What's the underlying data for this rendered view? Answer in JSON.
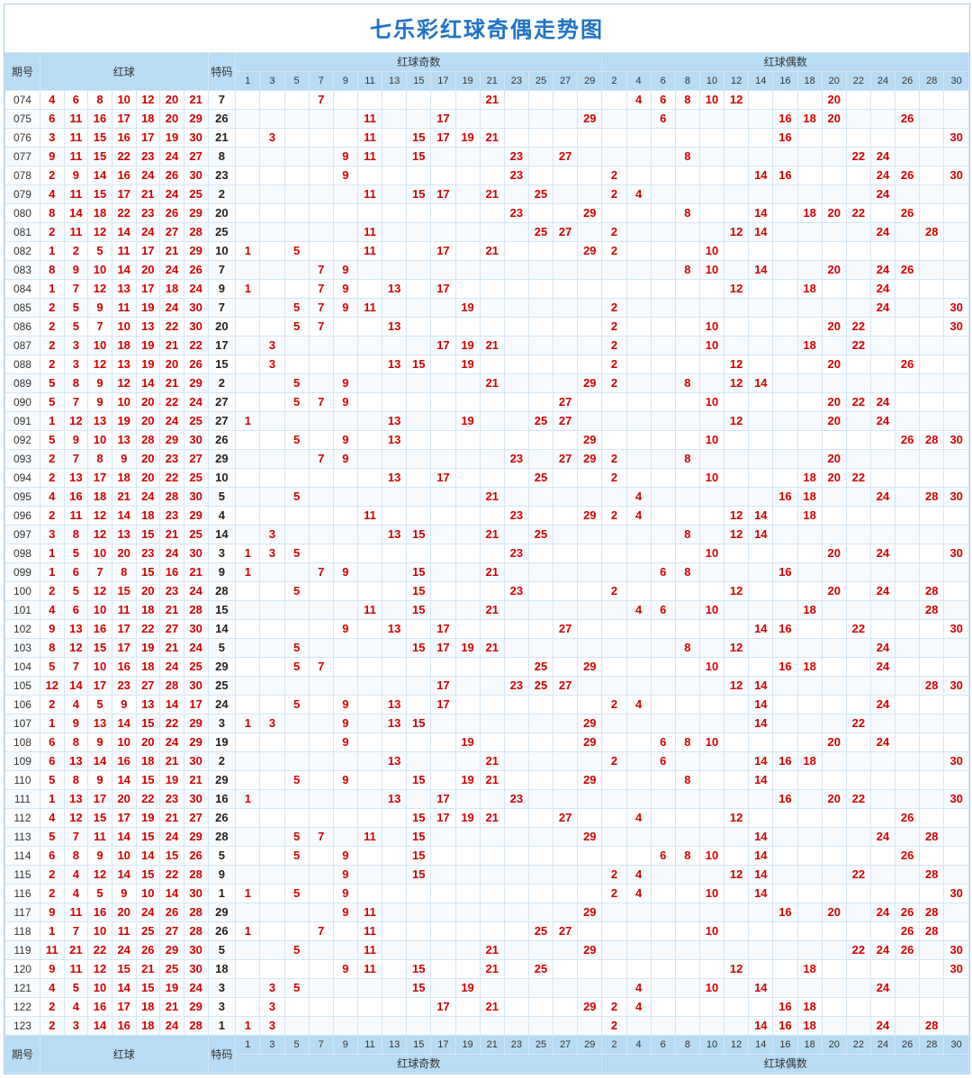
{
  "title": "七乐彩红球奇偶走势图",
  "headers": {
    "period": "期号",
    "red_balls": "红球",
    "bonus": "特码",
    "odd_group": "红球奇数",
    "even_group": "红球偶数"
  },
  "odd_columns": [
    1,
    3,
    5,
    7,
    9,
    11,
    13,
    15,
    17,
    19,
    21,
    23,
    25,
    27,
    29
  ],
  "even_columns": [
    2,
    4,
    6,
    8,
    10,
    12,
    14,
    16,
    18,
    20,
    22,
    24,
    26,
    28,
    30
  ],
  "chart_data": {
    "type": "table",
    "title": "七乐彩红球奇偶走势图",
    "columns_meta": [
      "period",
      "red1",
      "red2",
      "red3",
      "red4",
      "red5",
      "red6",
      "red7",
      "bonus"
    ],
    "odd_columns": [
      1,
      3,
      5,
      7,
      9,
      11,
      13,
      15,
      17,
      19,
      21,
      23,
      25,
      27,
      29
    ],
    "even_columns": [
      2,
      4,
      6,
      8,
      10,
      12,
      14,
      16,
      18,
      20,
      22,
      24,
      26,
      28,
      30
    ],
    "rows": [
      {
        "period": "074",
        "red": [
          4,
          6,
          8,
          10,
          12,
          20,
          21
        ],
        "bonus": 7
      },
      {
        "period": "075",
        "red": [
          6,
          11,
          16,
          17,
          18,
          20,
          29
        ],
        "bonus": 26
      },
      {
        "period": "076",
        "red": [
          3,
          11,
          15,
          16,
          17,
          19,
          30
        ],
        "bonus": 21
      },
      {
        "period": "077",
        "red": [
          9,
          11,
          15,
          22,
          23,
          24,
          27
        ],
        "bonus": 8
      },
      {
        "period": "078",
        "red": [
          2,
          9,
          14,
          16,
          24,
          26,
          30
        ],
        "bonus": 23
      },
      {
        "period": "079",
        "red": [
          4,
          11,
          15,
          17,
          21,
          24,
          25
        ],
        "bonus": 2
      },
      {
        "period": "080",
        "red": [
          8,
          14,
          18,
          22,
          23,
          26,
          29
        ],
        "bonus": 20
      },
      {
        "period": "081",
        "red": [
          2,
          11,
          12,
          14,
          24,
          27,
          28
        ],
        "bonus": 25
      },
      {
        "period": "082",
        "red": [
          1,
          2,
          5,
          11,
          17,
          21,
          29
        ],
        "bonus": 10
      },
      {
        "period": "083",
        "red": [
          8,
          9,
          10,
          14,
          20,
          24,
          26
        ],
        "bonus": 7
      },
      {
        "period": "084",
        "red": [
          1,
          7,
          12,
          13,
          17,
          18,
          24
        ],
        "bonus": 9
      },
      {
        "period": "085",
        "red": [
          2,
          5,
          9,
          11,
          19,
          24,
          30
        ],
        "bonus": 7
      },
      {
        "period": "086",
        "red": [
          2,
          5,
          7,
          10,
          13,
          22,
          30
        ],
        "bonus": 20
      },
      {
        "period": "087",
        "red": [
          2,
          3,
          10,
          18,
          19,
          21,
          22
        ],
        "bonus": 17
      },
      {
        "period": "088",
        "red": [
          2,
          3,
          12,
          13,
          19,
          20,
          26
        ],
        "bonus": 15
      },
      {
        "period": "089",
        "red": [
          5,
          8,
          9,
          12,
          14,
          21,
          29
        ],
        "bonus": 2
      },
      {
        "period": "090",
        "red": [
          5,
          7,
          9,
          10,
          20,
          22,
          24
        ],
        "bonus": 27
      },
      {
        "period": "091",
        "red": [
          1,
          12,
          13,
          19,
          20,
          24,
          25
        ],
        "bonus": 27
      },
      {
        "period": "092",
        "red": [
          5,
          9,
          10,
          13,
          28,
          29,
          30
        ],
        "bonus": 26
      },
      {
        "period": "093",
        "red": [
          2,
          7,
          8,
          9,
          20,
          23,
          27
        ],
        "bonus": 29
      },
      {
        "period": "094",
        "red": [
          2,
          13,
          17,
          18,
          20,
          22,
          25
        ],
        "bonus": 10
      },
      {
        "period": "095",
        "red": [
          4,
          16,
          18,
          21,
          24,
          28,
          30
        ],
        "bonus": 5
      },
      {
        "period": "096",
        "red": [
          2,
          11,
          12,
          14,
          18,
          23,
          29
        ],
        "bonus": 4
      },
      {
        "period": "097",
        "red": [
          3,
          8,
          12,
          13,
          15,
          21,
          25
        ],
        "bonus": 14
      },
      {
        "period": "098",
        "red": [
          1,
          5,
          10,
          20,
          23,
          24,
          30
        ],
        "bonus": 3
      },
      {
        "period": "099",
        "red": [
          1,
          6,
          7,
          8,
          15,
          16,
          21
        ],
        "bonus": 9
      },
      {
        "period": "100",
        "red": [
          2,
          5,
          12,
          15,
          20,
          23,
          24
        ],
        "bonus": 28
      },
      {
        "period": "101",
        "red": [
          4,
          6,
          10,
          11,
          18,
          21,
          28
        ],
        "bonus": 15
      },
      {
        "period": "102",
        "red": [
          9,
          13,
          16,
          17,
          22,
          27,
          30
        ],
        "bonus": 14
      },
      {
        "period": "103",
        "red": [
          8,
          12,
          15,
          17,
          19,
          21,
          24
        ],
        "bonus": 5
      },
      {
        "period": "104",
        "red": [
          5,
          7,
          10,
          16,
          18,
          24,
          25
        ],
        "bonus": 29
      },
      {
        "period": "105",
        "red": [
          12,
          14,
          17,
          23,
          27,
          28,
          30
        ],
        "bonus": 25
      },
      {
        "period": "106",
        "red": [
          2,
          4,
          5,
          9,
          13,
          14,
          17
        ],
        "bonus": 24
      },
      {
        "period": "107",
        "red": [
          1,
          9,
          13,
          14,
          15,
          22,
          29
        ],
        "bonus": 3
      },
      {
        "period": "108",
        "red": [
          6,
          8,
          9,
          10,
          20,
          24,
          29
        ],
        "bonus": 19
      },
      {
        "period": "109",
        "red": [
          6,
          13,
          14,
          16,
          18,
          21,
          30
        ],
        "bonus": 2
      },
      {
        "period": "110",
        "red": [
          5,
          8,
          9,
          14,
          15,
          19,
          21
        ],
        "bonus": 29
      },
      {
        "period": "111",
        "red": [
          1,
          13,
          17,
          20,
          22,
          23,
          30
        ],
        "bonus": 16
      },
      {
        "period": "112",
        "red": [
          4,
          12,
          15,
          17,
          19,
          21,
          27
        ],
        "bonus": 26
      },
      {
        "period": "113",
        "red": [
          5,
          7,
          11,
          14,
          15,
          24,
          29
        ],
        "bonus": 28
      },
      {
        "period": "114",
        "red": [
          6,
          8,
          9,
          10,
          14,
          15,
          26
        ],
        "bonus": 5
      },
      {
        "period": "115",
        "red": [
          2,
          4,
          12,
          14,
          15,
          22,
          28
        ],
        "bonus": 9
      },
      {
        "period": "116",
        "red": [
          2,
          4,
          5,
          9,
          10,
          14,
          30
        ],
        "bonus": 1
      },
      {
        "period": "117",
        "red": [
          9,
          11,
          16,
          20,
          24,
          26,
          28
        ],
        "bonus": 29
      },
      {
        "period": "118",
        "red": [
          1,
          7,
          10,
          11,
          25,
          27,
          28
        ],
        "bonus": 26
      },
      {
        "period": "119",
        "red": [
          11,
          21,
          22,
          24,
          26,
          29,
          30
        ],
        "bonus": 5
      },
      {
        "period": "120",
        "red": [
          9,
          11,
          12,
          15,
          21,
          25,
          30
        ],
        "bonus": 18
      },
      {
        "period": "121",
        "red": [
          4,
          5,
          10,
          14,
          15,
          19,
          24
        ],
        "bonus": 3
      },
      {
        "period": "122",
        "red": [
          2,
          4,
          16,
          17,
          18,
          21,
          29
        ],
        "bonus": 3
      },
      {
        "period": "123",
        "red": [
          2,
          3,
          14,
          16,
          18,
          24,
          28
        ],
        "bonus": 1
      }
    ]
  }
}
